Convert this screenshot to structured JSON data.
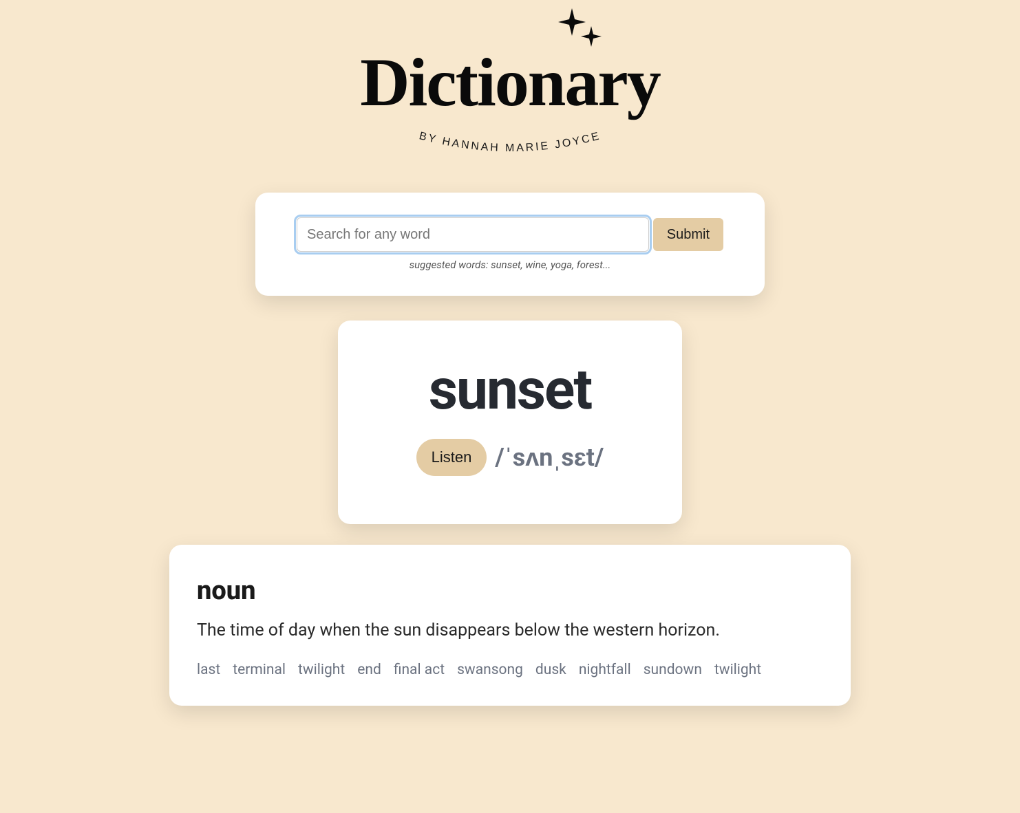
{
  "logo": {
    "title": "Dictionary",
    "byline": "BY HANNAH MARIE JOYCE"
  },
  "search": {
    "placeholder": "Search for any word",
    "submit_label": "Submit",
    "suggested": "suggested words: sunset, wine, yoga, forest..."
  },
  "word": {
    "title": "sunset",
    "listen_label": "Listen",
    "phonetic": "/ˈsʌnˌsɛt/"
  },
  "definition": {
    "part_of_speech": "noun",
    "text": "The time of day when the sun disappears below the western horizon.",
    "synonyms": [
      "last",
      "terminal",
      "twilight",
      "end",
      "final act",
      "swansong",
      "dusk",
      "nightfall",
      "sundown",
      "twilight"
    ]
  }
}
